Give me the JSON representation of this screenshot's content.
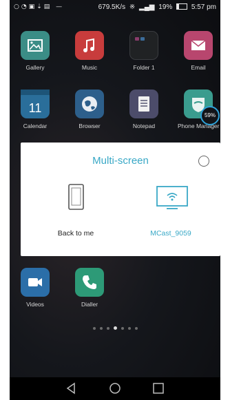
{
  "status_bar": {
    "network_speed": "679.5K/s",
    "battery_percent": "19%",
    "time": "5:57 pm",
    "notification_icons": [
      "vpn-icon",
      "sync-icon",
      "sim-icon",
      "download-icon",
      "image-icon"
    ]
  },
  "home": {
    "row1": [
      {
        "label": "Gallery",
        "icon": "gallery-icon"
      },
      {
        "label": "Music",
        "icon": "music-icon"
      },
      {
        "label": "Folder 1",
        "icon": "folder-icon"
      },
      {
        "label": "Email",
        "icon": "email-icon"
      }
    ],
    "row2": [
      {
        "label": "Calendar",
        "icon": "calendar-icon",
        "date": "11"
      },
      {
        "label": "Browser",
        "icon": "browser-icon"
      },
      {
        "label": "Notepad",
        "icon": "notepad-icon"
      },
      {
        "label": "Phone Manager",
        "icon": "phone-manager-icon",
        "badge": "59%"
      }
    ],
    "row3": [
      {
        "label": "Videos",
        "icon": "videos-icon"
      },
      {
        "label": "Dialler",
        "icon": "dialler-icon"
      }
    ],
    "page_count": 7,
    "active_page": 4
  },
  "dialog": {
    "title": "Multi-screen",
    "options": [
      {
        "label": "Back to me",
        "icon": "phone-device-icon"
      },
      {
        "label": "MCast_9059",
        "icon": "wireless-display-icon"
      }
    ]
  },
  "nav_bar": {
    "buttons": [
      "back-icon",
      "home-icon",
      "recents-icon"
    ]
  },
  "colors": {
    "accent": "#38a8c6",
    "dialog_bg": "#ffffff"
  }
}
